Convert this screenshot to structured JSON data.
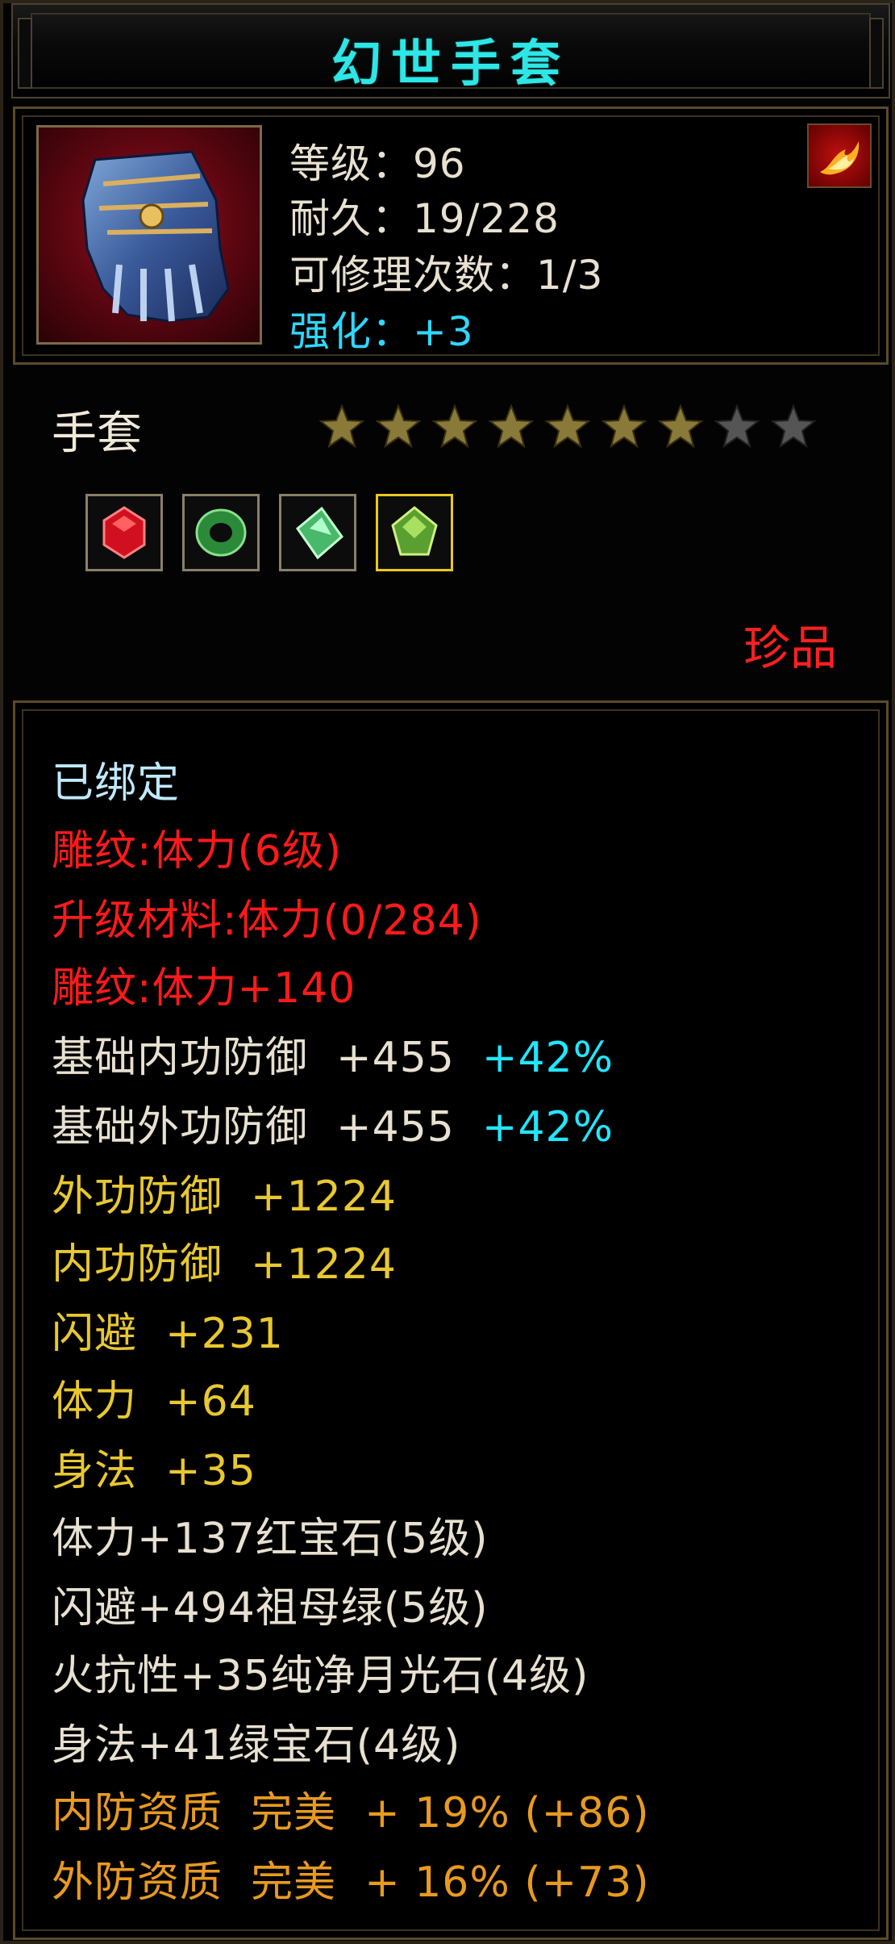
{
  "title": "幻世手套",
  "header": {
    "level": "等级：96",
    "durability": "耐久：19/228",
    "repairs": "可修理次数：1/3",
    "enhance": "强化：+3"
  },
  "item_type": "手套",
  "stars": {
    "filled": 7,
    "total": 9
  },
  "gems": [
    "red-gem-icon",
    "green-jade-icon",
    "moonstone-icon",
    "green-gem-icon"
  ],
  "rarity": "珍品",
  "attributes": {
    "bound": "已绑定",
    "carve1": "雕纹:体力(6级)",
    "upgrade": "升级材料:体力(0/284)",
    "carve2": "雕纹:体力+140",
    "base_inner": "基础内功防御  +455",
    "base_inner_pct": "+42%",
    "base_outer": "基础外功防御  +455",
    "base_outer_pct": "+42%",
    "outer_def": "外功防御  +1224",
    "inner_def": "内功防御  +1224",
    "dodge": "闪避  +231",
    "stamina": "体力  +64",
    "agility": "身法  +35",
    "gem1": "体力+137红宝石(5级)",
    "gem2": "闪避+494祖母绿(5级)",
    "gem3": "火抗性+35纯净月光石(4级)",
    "gem4": "身法+41绿宝石(4级)",
    "quality1": "内防资质  完美  + 19% (+86)",
    "quality2": "外防资质  完美  + 16% (+73)"
  },
  "colors": {
    "title": "#2ee6e6",
    "red": "#ff1a1a",
    "gold": "#e8c830",
    "orange": "#e89a20",
    "cyan": "#22e6ff"
  }
}
